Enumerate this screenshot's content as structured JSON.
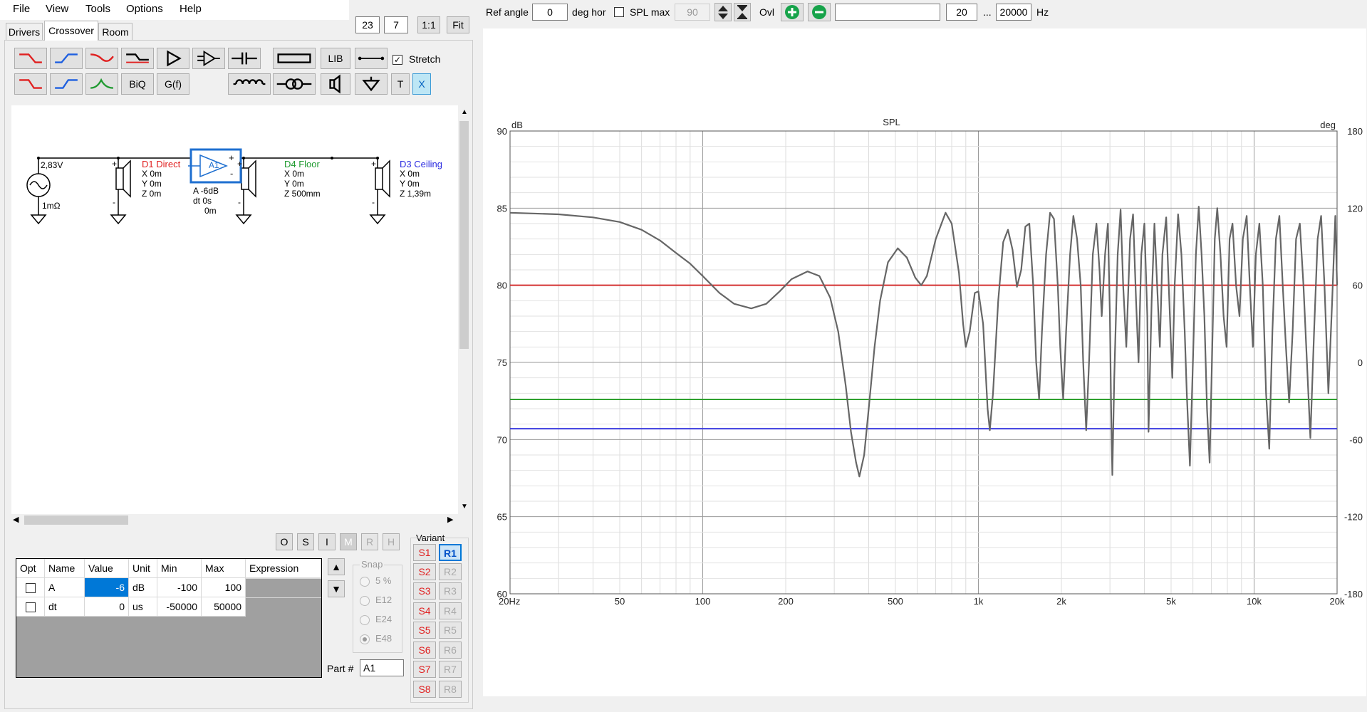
{
  "menu": {
    "file": "File",
    "view": "View",
    "tools": "Tools",
    "options": "Options",
    "help": "Help"
  },
  "zoom": {
    "val1": "23",
    "val2": "7",
    "one_to_one": "1:1",
    "fit": "Fit"
  },
  "tabs": {
    "drivers": "Drivers",
    "crossover": "Crossover",
    "room": "Room"
  },
  "toolbar": {
    "lib": "LIB",
    "biq": "BiQ",
    "gf": "G(f)",
    "t": "T",
    "x": "X",
    "stretch": "Stretch"
  },
  "schematic": {
    "source_voltage": "2,83V",
    "source_impedance": "1mΩ",
    "d1": {
      "name": "D1 Direct",
      "x": "X 0m",
      "y": "Y 0m",
      "z": "Z 0m"
    },
    "amp": {
      "name": "A1",
      "gain": "A  -6dB",
      "dt": "dt 0s",
      "dist": "0m"
    },
    "d4": {
      "name": "D4 Floor",
      "x": "X 0m",
      "y": "Y 0m",
      "z": "Z 500mm"
    },
    "d3": {
      "name": "D3 Ceiling",
      "x": "X 0m",
      "y": "Y 0m",
      "z": "Z 1,39m"
    }
  },
  "osi_buttons": [
    "O",
    "S",
    "I",
    "M",
    "R",
    "H"
  ],
  "params": {
    "headers": [
      "Opt",
      "Name",
      "Value",
      "Unit",
      "Min",
      "Max",
      "Expression"
    ],
    "rows": [
      {
        "name": "A",
        "value": "-6",
        "unit": "dB",
        "min": "-100",
        "max": "100",
        "expr": ""
      },
      {
        "name": "dt",
        "value": "0",
        "unit": "us",
        "min": "-50000",
        "max": "50000",
        "expr": ""
      }
    ]
  },
  "snap": {
    "title": "Snap",
    "options": [
      "5 %",
      "E12",
      "E24",
      "E48"
    ],
    "selected": "E48"
  },
  "part": {
    "label": "Part #",
    "value": "A1"
  },
  "variant": {
    "title": "Variant",
    "s": [
      "S1",
      "S2",
      "S3",
      "S4",
      "S5",
      "S6",
      "S7",
      "S8"
    ],
    "r": [
      "R1",
      "R2",
      "R3",
      "R4",
      "R5",
      "R6",
      "R7",
      "R8"
    ]
  },
  "top": {
    "ref_angle_label": "Ref angle",
    "ref_angle": "0",
    "deg_hor": "deg hor",
    "spl_max_label": "SPL max",
    "spl_max": "90",
    "ovl": "Ovl",
    "freq_min": "20",
    "ellipsis": "...",
    "freq_max": "20000",
    "hz": "Hz"
  },
  "chart_data": {
    "type": "line",
    "title": "SPL",
    "ylabel": "dB",
    "y2label": "deg",
    "xscale": "log",
    "xlim": [
      20,
      20000
    ],
    "ylim": [
      60,
      90
    ],
    "y2lim": [
      -180,
      180
    ],
    "grid": true,
    "xticks": [
      {
        "v": 20,
        "l": "20Hz"
      },
      {
        "v": 50,
        "l": "50"
      },
      {
        "v": 100,
        "l": "100"
      },
      {
        "v": 200,
        "l": "200"
      },
      {
        "v": 500,
        "l": "500"
      },
      {
        "v": 1000,
        "l": "1k"
      },
      {
        "v": 2000,
        "l": "2k"
      },
      {
        "v": 5000,
        "l": "5k"
      },
      {
        "v": 10000,
        "l": "10k"
      },
      {
        "v": 20000,
        "l": "20k"
      }
    ],
    "yticks": [
      60,
      65,
      70,
      75,
      80,
      85,
      90
    ],
    "y2ticks": [
      -180,
      -120,
      -60,
      0,
      60,
      120,
      180
    ],
    "hlines": [
      {
        "y": 80,
        "color": "#d43030"
      },
      {
        "y": 72.6,
        "color": "#2fa02f"
      },
      {
        "y": 70.7,
        "color": "#3b3bdf"
      }
    ],
    "series": [
      {
        "color": "#666666",
        "points": [
          [
            20,
            84.7
          ],
          [
            30,
            84.6
          ],
          [
            40,
            84.4
          ],
          [
            50,
            84.1
          ],
          [
            60,
            83.6
          ],
          [
            70,
            82.9
          ],
          [
            80,
            82.1
          ],
          [
            90,
            81.4
          ],
          [
            100,
            80.6
          ],
          [
            115,
            79.5
          ],
          [
            130,
            78.8
          ],
          [
            150,
            78.5
          ],
          [
            170,
            78.8
          ],
          [
            190,
            79.6
          ],
          [
            210,
            80.4
          ],
          [
            240,
            80.9
          ],
          [
            265,
            80.6
          ],
          [
            290,
            79.2
          ],
          [
            310,
            77
          ],
          [
            330,
            73.5
          ],
          [
            345,
            70.5
          ],
          [
            360,
            68.5
          ],
          [
            370,
            67.6
          ],
          [
            385,
            69
          ],
          [
            400,
            72
          ],
          [
            420,
            76
          ],
          [
            440,
            79
          ],
          [
            470,
            81.5
          ],
          [
            510,
            82.4
          ],
          [
            550,
            81.8
          ],
          [
            590,
            80.5
          ],
          [
            620,
            80
          ],
          [
            650,
            80.6
          ],
          [
            700,
            83
          ],
          [
            760,
            84.7
          ],
          [
            800,
            84
          ],
          [
            850,
            80.8
          ],
          [
            880,
            77.5
          ],
          [
            900,
            76
          ],
          [
            930,
            77
          ],
          [
            970,
            79.5
          ],
          [
            1000,
            79.6
          ],
          [
            1040,
            77.5
          ],
          [
            1080,
            72
          ],
          [
            1100,
            70.6
          ],
          [
            1130,
            73
          ],
          [
            1180,
            79
          ],
          [
            1230,
            82.8
          ],
          [
            1280,
            83.6
          ],
          [
            1330,
            82.3
          ],
          [
            1380,
            79.9
          ],
          [
            1430,
            81
          ],
          [
            1480,
            83.8
          ],
          [
            1530,
            84
          ],
          [
            1580,
            80
          ],
          [
            1620,
            75
          ],
          [
            1660,
            72.6
          ],
          [
            1700,
            77
          ],
          [
            1760,
            82
          ],
          [
            1820,
            84.7
          ],
          [
            1880,
            84.3
          ],
          [
            1940,
            80
          ],
          [
            1980,
            76
          ],
          [
            2030,
            72.6
          ],
          [
            2080,
            77
          ],
          [
            2150,
            82
          ],
          [
            2210,
            84.5
          ],
          [
            2280,
            83
          ],
          [
            2350,
            80
          ],
          [
            2400,
            75
          ],
          [
            2460,
            70.6
          ],
          [
            2520,
            75
          ],
          [
            2600,
            82
          ],
          [
            2680,
            84
          ],
          [
            2750,
            81
          ],
          [
            2800,
            78
          ],
          [
            2880,
            82
          ],
          [
            2950,
            84
          ],
          [
            3000,
            78
          ],
          [
            3030,
            72
          ],
          [
            3060,
            67.7
          ],
          [
            3110,
            74
          ],
          [
            3200,
            82
          ],
          [
            3280,
            84.9
          ],
          [
            3350,
            80
          ],
          [
            3440,
            76
          ],
          [
            3550,
            83
          ],
          [
            3640,
            84.6
          ],
          [
            3730,
            79
          ],
          [
            3810,
            75
          ],
          [
            3900,
            82
          ],
          [
            4000,
            84
          ],
          [
            4100,
            78
          ],
          [
            4140,
            70.5
          ],
          [
            4250,
            79
          ],
          [
            4350,
            84
          ],
          [
            4450,
            80
          ],
          [
            4550,
            76
          ],
          [
            4650,
            82
          ],
          [
            4800,
            84.4
          ],
          [
            4950,
            78
          ],
          [
            5050,
            74
          ],
          [
            5150,
            80
          ],
          [
            5300,
            84.6
          ],
          [
            5450,
            82
          ],
          [
            5600,
            77
          ],
          [
            5700,
            73
          ],
          [
            5850,
            68.3
          ],
          [
            6000,
            75
          ],
          [
            6150,
            82
          ],
          [
            6300,
            85.1
          ],
          [
            6450,
            82
          ],
          [
            6600,
            78
          ],
          [
            6750,
            72
          ],
          [
            6900,
            68.5
          ],
          [
            7050,
            76
          ],
          [
            7200,
            83
          ],
          [
            7350,
            85
          ],
          [
            7550,
            82
          ],
          [
            7750,
            78
          ],
          [
            7950,
            76
          ],
          [
            8150,
            83
          ],
          [
            8350,
            84
          ],
          [
            8600,
            80
          ],
          [
            8850,
            78
          ],
          [
            9100,
            83
          ],
          [
            9400,
            84.5
          ],
          [
            9650,
            80
          ],
          [
            9900,
            76
          ],
          [
            10150,
            82
          ],
          [
            10450,
            84
          ],
          [
            10750,
            80
          ],
          [
            11050,
            73
          ],
          [
            11350,
            69.4
          ],
          [
            11650,
            77
          ],
          [
            12000,
            83
          ],
          [
            12350,
            84.5
          ],
          [
            12700,
            80
          ],
          [
            13050,
            76
          ],
          [
            13400,
            72.4
          ],
          [
            13800,
            77
          ],
          [
            14200,
            83
          ],
          [
            14650,
            84
          ],
          [
            15100,
            80
          ],
          [
            15550,
            75
          ],
          [
            16000,
            70.1
          ],
          [
            16500,
            77
          ],
          [
            17000,
            83
          ],
          [
            17500,
            84.5
          ],
          [
            18000,
            80
          ],
          [
            18600,
            73
          ],
          [
            19200,
            79
          ],
          [
            19700,
            84.5
          ],
          [
            20000,
            80
          ]
        ]
      }
    ]
  }
}
